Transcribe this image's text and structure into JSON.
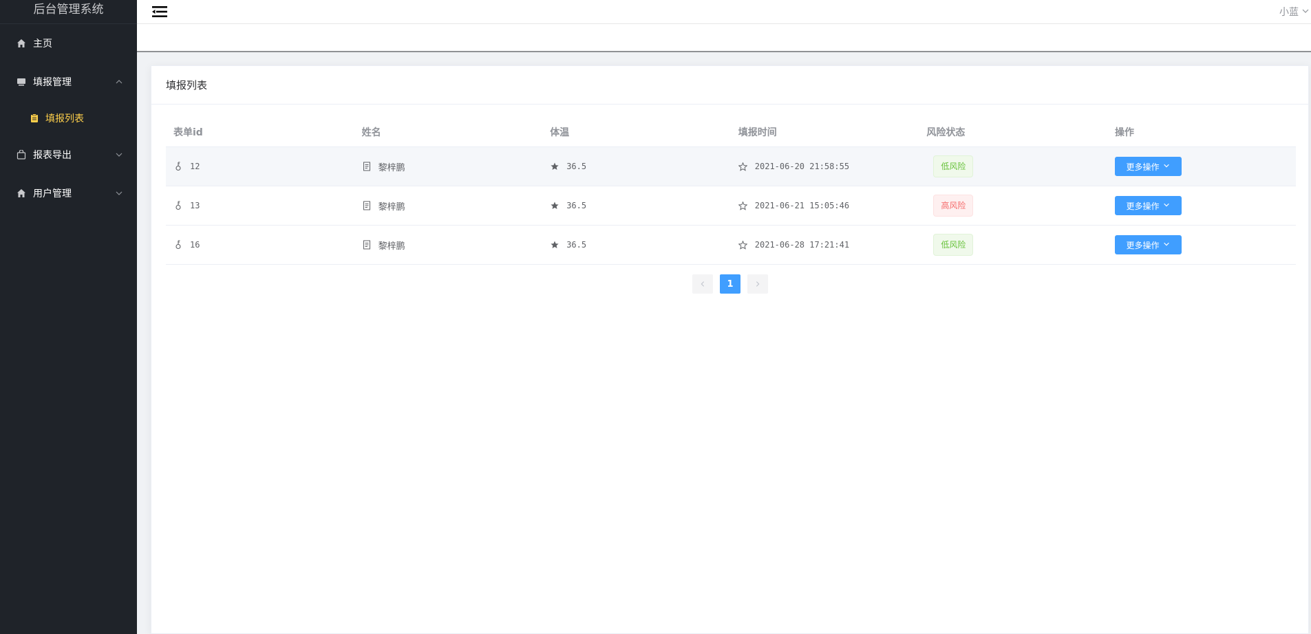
{
  "app": {
    "title": "后台管理系统"
  },
  "sidebar": {
    "items": [
      {
        "label": "主页",
        "icon": "home-icon"
      },
      {
        "label": "填报管理",
        "icon": "monitor-icon",
        "expanded": true,
        "children": [
          {
            "label": "填报列表",
            "icon": "clipboard-icon",
            "active": true
          }
        ]
      },
      {
        "label": "报表导出",
        "icon": "bag-icon",
        "expanded": false
      },
      {
        "label": "用户管理",
        "icon": "home-icon",
        "expanded": false
      }
    ],
    "active_color": "#ffd04b",
    "background": "#1f2329"
  },
  "header": {
    "user_name": "小蓝"
  },
  "card": {
    "title": "填报列表"
  },
  "table": {
    "columns": [
      "表单id",
      "姓名",
      "体温",
      "填报时间",
      "风险状态",
      "操作"
    ],
    "rows": [
      {
        "id": "12",
        "name": "黎梓鹏",
        "temp": "36.5",
        "time": "2021-06-20 21:58:55",
        "risk": "低风险",
        "action": "更多操作"
      },
      {
        "id": "13",
        "name": "黎梓鹏",
        "temp": "36.5",
        "time": "2021-06-21 15:05:46",
        "risk": "高风险",
        "action": "更多操作"
      },
      {
        "id": "16",
        "name": "黎梓鹏",
        "temp": "36.5",
        "time": "2021-06-28 17:21:41",
        "risk": "低风险",
        "action": "更多操作"
      }
    ]
  },
  "pagination": {
    "current_page": "1"
  },
  "colors": {
    "primary": "#409eff",
    "low_risk": "#67c23a",
    "high_risk": "#f56c6c"
  }
}
